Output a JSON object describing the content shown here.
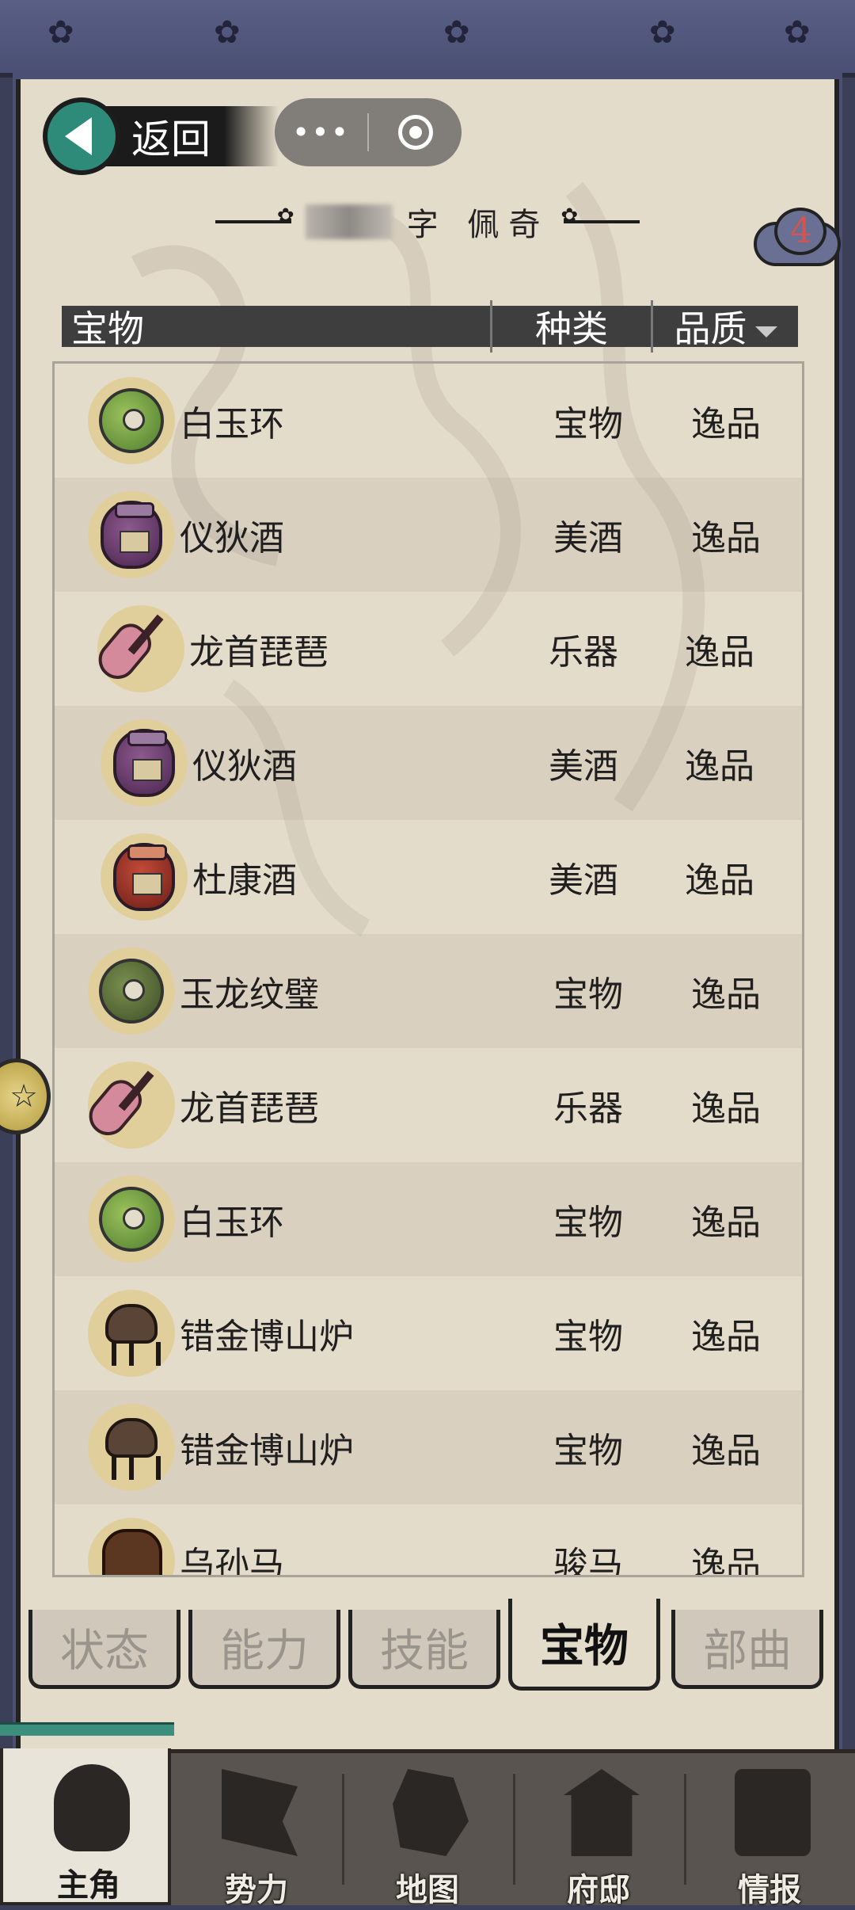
{
  "header_bar": {
    "back_label": "返回",
    "more_glyph": "•••"
  },
  "character": {
    "name_suffix": "字 佩奇",
    "badge_count": "4"
  },
  "columns": {
    "name": "宝物",
    "type": "种类",
    "quality": "品质"
  },
  "items": [
    {
      "name": "白玉环",
      "type": "宝物",
      "quality": "逸品",
      "icon": "jade-ring-icon"
    },
    {
      "name": "仪狄酒",
      "type": "美酒",
      "quality": "逸品",
      "icon": "wine-jar-icon"
    },
    {
      "name": "龙首琵琶",
      "type": "乐器",
      "quality": "逸品",
      "icon": "pipa-icon"
    },
    {
      "name": "仪狄酒",
      "type": "美酒",
      "quality": "逸品",
      "icon": "wine-jar-icon"
    },
    {
      "name": "杜康酒",
      "type": "美酒",
      "quality": "逸品",
      "icon": "red-wine-jar-icon"
    },
    {
      "name": "玉龙纹璧",
      "type": "宝物",
      "quality": "逸品",
      "icon": "jade-disc-icon"
    },
    {
      "name": "龙首琵琶",
      "type": "乐器",
      "quality": "逸品",
      "icon": "pipa-icon"
    },
    {
      "name": "白玉环",
      "type": "宝物",
      "quality": "逸品",
      "icon": "jade-ring-icon"
    },
    {
      "name": "错金博山炉",
      "type": "宝物",
      "quality": "逸品",
      "icon": "censer-icon"
    },
    {
      "name": "错金博山炉",
      "type": "宝物",
      "quality": "逸品",
      "icon": "censer-icon"
    },
    {
      "name": "乌孙马",
      "type": "骏马",
      "quality": "逸品",
      "icon": "horse-icon"
    }
  ],
  "tabs": [
    {
      "label": "状态",
      "active": false
    },
    {
      "label": "能力",
      "active": false
    },
    {
      "label": "技能",
      "active": false
    },
    {
      "label": "宝物",
      "active": true
    },
    {
      "label": "部曲",
      "active": false
    }
  ],
  "bottom_nav": [
    {
      "label": "主角",
      "icon": "helmet-icon",
      "active": true
    },
    {
      "label": "势力",
      "icon": "flag-icon",
      "active": false
    },
    {
      "label": "地图",
      "icon": "map-icon",
      "active": false
    },
    {
      "label": "府邸",
      "icon": "mansion-icon",
      "active": false
    },
    {
      "label": "情报",
      "icon": "scroll-icon",
      "active": false
    }
  ],
  "colors": {
    "frame": "#4a4f73",
    "paper": "#e4dccb",
    "header_bar": "#3e3e3e",
    "back_circle": "#2f8b79",
    "badge_number": "#d7534f"
  }
}
